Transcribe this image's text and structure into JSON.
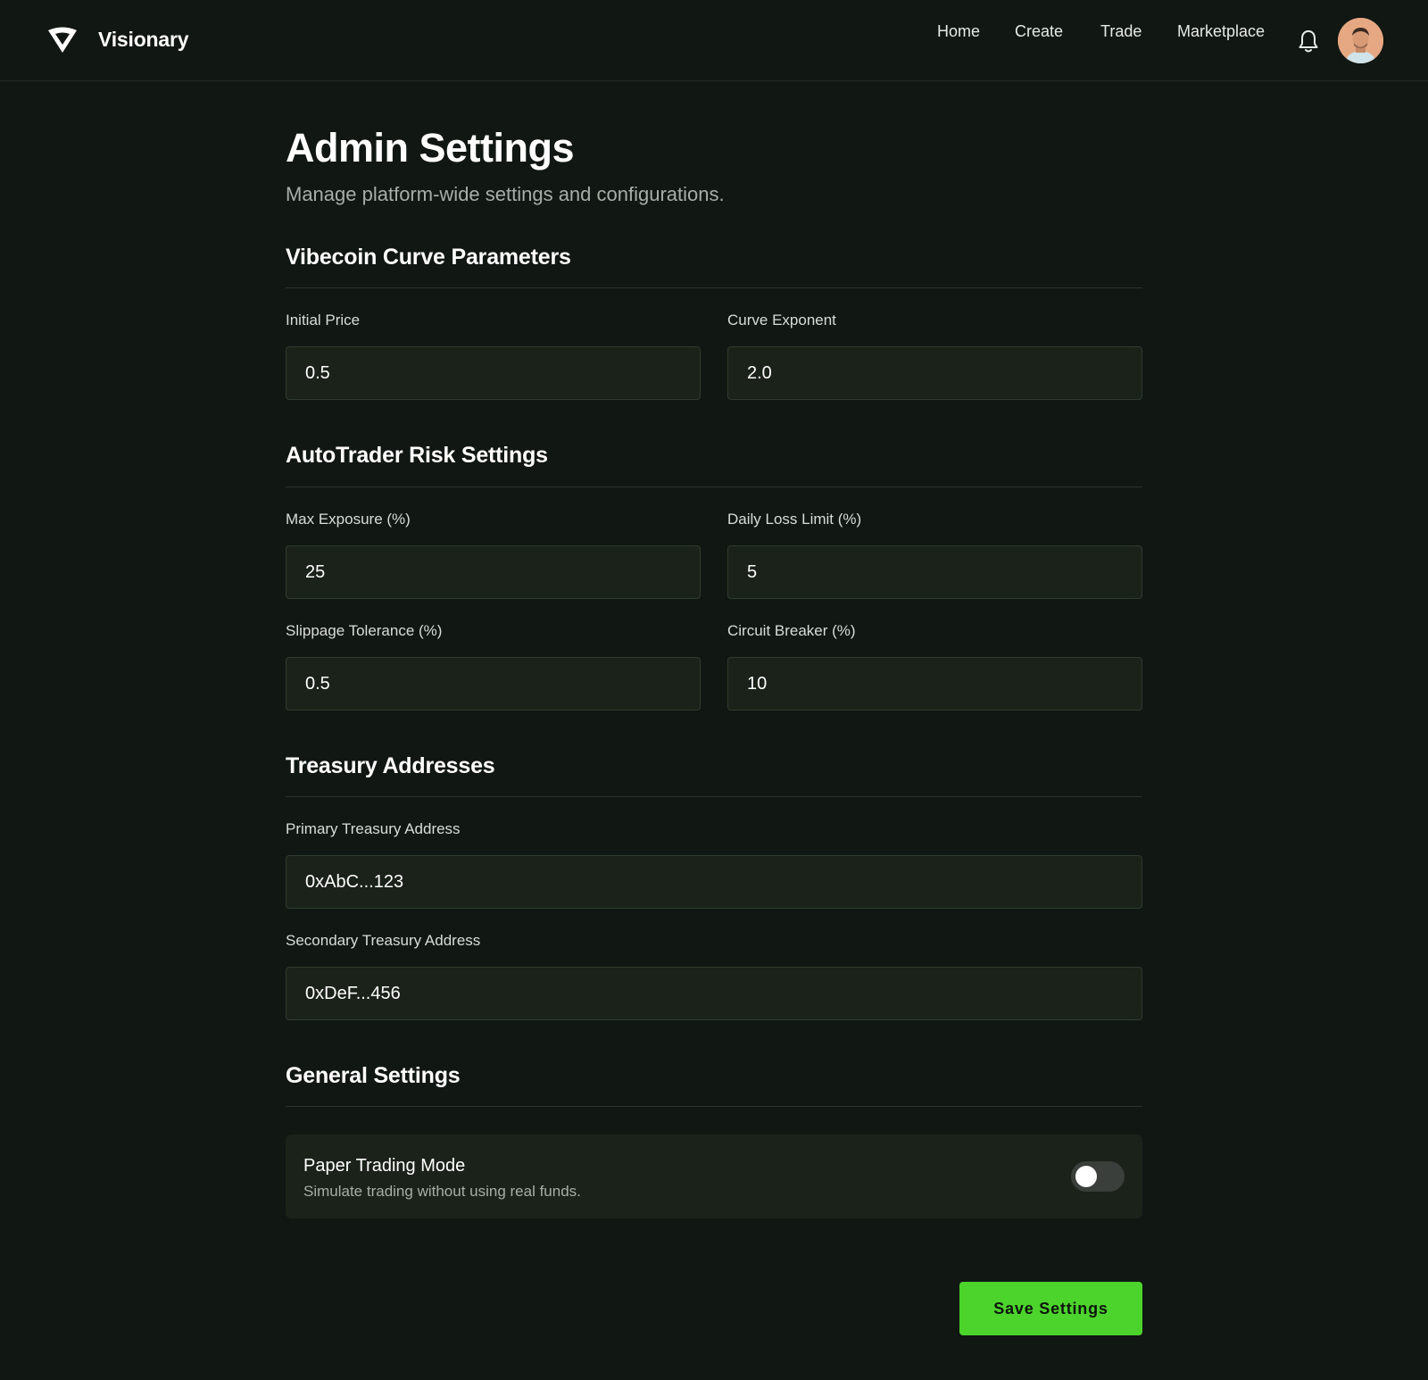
{
  "brand": {
    "name": "Visionary"
  },
  "nav": {
    "links": [
      "Home",
      "Create",
      "Trade",
      "Marketplace"
    ]
  },
  "page": {
    "title": "Admin Settings",
    "subtitle": "Manage platform-wide settings and configurations."
  },
  "sections": {
    "curve": {
      "title": "Vibecoin Curve Parameters",
      "initial_price": {
        "label": "Initial Price",
        "value": "0.5"
      },
      "curve_exponent": {
        "label": "Curve Exponent",
        "value": "2.0"
      }
    },
    "risk": {
      "title": "AutoTrader Risk Settings",
      "max_exposure": {
        "label": "Max Exposure (%)",
        "value": "25"
      },
      "daily_loss_limit": {
        "label": "Daily Loss Limit (%)",
        "value": "5"
      },
      "slippage_tolerance": {
        "label": "Slippage Tolerance (%)",
        "value": "0.5"
      },
      "circuit_breaker": {
        "label": "Circuit Breaker (%)",
        "value": "10"
      }
    },
    "treasury": {
      "title": "Treasury Addresses",
      "primary": {
        "label": "Primary Treasury Address",
        "value": "0xAbC...123"
      },
      "secondary": {
        "label": "Secondary Treasury Address",
        "value": "0xDeF...456"
      }
    },
    "general": {
      "title": "General Settings",
      "paper_trading": {
        "title": "Paper Trading Mode",
        "description": "Simulate trading without using real funds.",
        "enabled": false
      }
    }
  },
  "actions": {
    "save_label": "Save Settings"
  },
  "colors": {
    "background": "#111712",
    "input_bg": "#1a2219",
    "accent": "#4cd42d"
  },
  "icons": [
    "logo-icon",
    "bell-icon",
    "avatar"
  ]
}
